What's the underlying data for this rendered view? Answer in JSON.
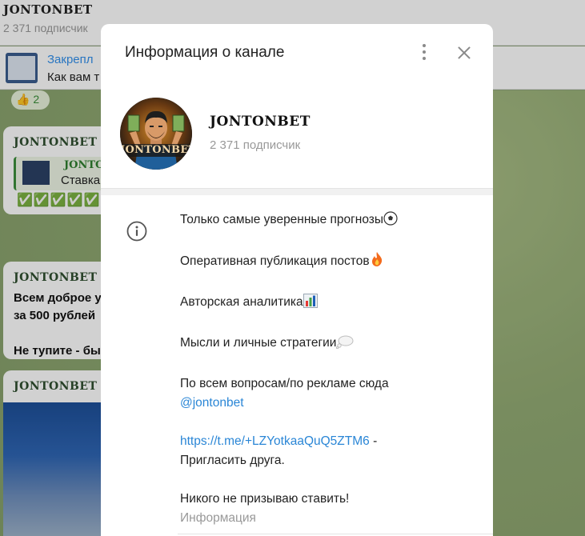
{
  "background": {
    "channel_title": "JONTONBET",
    "subscribers": "2 371 подписчик",
    "pinned_title": "Закрепл",
    "pinned_text": "Как вам т",
    "reaction": "👍 2",
    "messages": [
      {
        "author": "JONTONBET",
        "quote_author": "JONTONBET",
        "quote_text": "Ставка",
        "checks": "✅✅✅✅✅"
      },
      {
        "author": "JONTONBET",
        "text": "Всем доброе у\nза 500 рублей\n\nНе тупите - бы"
      },
      {
        "author": "JONTONBET"
      }
    ]
  },
  "modal": {
    "title": "Информация о канале",
    "channel_name": "JONTONBET",
    "subscribers": "2 371 подписчик",
    "avatar_text": "JONTONBET",
    "description": {
      "line1": "Только самые уверенные прогнозы",
      "line2": "Оперативная публикация постов",
      "line3": "Авторская аналитика",
      "line4": "Мысли и личные стратегии",
      "line5": "По всем вопросам/по рекламе сюда",
      "mention": "@jontonbet",
      "invite_link": "https://t.me/+LZYotkaaQuQ5ZTM6",
      "invite_suffix": " -",
      "invite_text": "Пригласить друга.",
      "disclaimer": "Никого не призываю ставить!"
    },
    "label": "Информация"
  },
  "icons": {
    "menu": "kebab-icon",
    "close": "close-icon",
    "info": "info-icon"
  },
  "colors": {
    "link": "#2a86d6",
    "muted": "#999999",
    "check": "#3aa33a"
  }
}
